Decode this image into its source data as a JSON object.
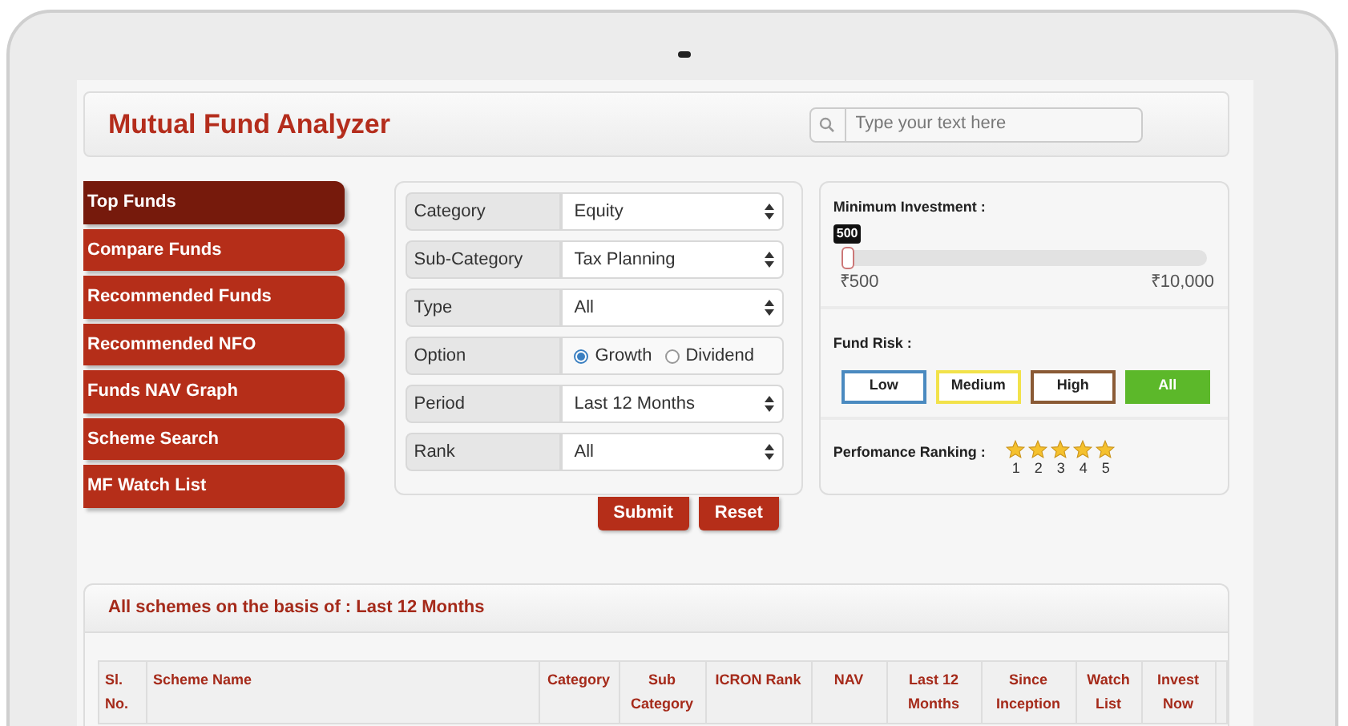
{
  "header": {
    "title": "Mutual Fund Analyzer",
    "search": {
      "placeholder": "Type your text here"
    }
  },
  "sidebar": {
    "items": [
      {
        "label": "Top Funds",
        "selected": true
      },
      {
        "label": "Compare Funds",
        "selected": false
      },
      {
        "label": "Recommended Funds",
        "selected": false
      },
      {
        "label": "Recommended NFO",
        "selected": false
      },
      {
        "label": "Funds NAV Graph",
        "selected": false
      },
      {
        "label": "Scheme Search",
        "selected": false
      },
      {
        "label": "MF Watch List",
        "selected": false
      }
    ]
  },
  "filters": {
    "rows": [
      {
        "label": "Category",
        "kind": "select",
        "value": "Equity"
      },
      {
        "label": "Sub-Category",
        "kind": "select",
        "value": "Tax Planning"
      },
      {
        "label": "Type",
        "kind": "select",
        "value": "All"
      },
      {
        "label": "Option",
        "kind": "radio",
        "options": [
          {
            "label": "Growth",
            "selected": true
          },
          {
            "label": "Dividend",
            "selected": false
          }
        ]
      },
      {
        "label": "Period",
        "kind": "select",
        "value": "Last 12 Months"
      },
      {
        "label": "Rank",
        "kind": "select",
        "value": "All"
      }
    ]
  },
  "buttons": [
    "Submit",
    "Reset"
  ],
  "min_investment": {
    "label": "Minimum Investment :",
    "reading": "500",
    "level": 0,
    "min_label": "₹500",
    "max_label": "₹10,000"
  },
  "fund_risk": {
    "label": "Fund Risk :",
    "options": [
      {
        "label": "Low",
        "color": "#4a8ac0",
        "selected": false
      },
      {
        "label": "Medium",
        "color": "#f2e24a",
        "selected": false
      },
      {
        "label": "High",
        "color": "#8a5a35",
        "selected": false
      },
      {
        "label": "All",
        "color": "#5cb82a",
        "selected": true
      }
    ]
  },
  "ranking": {
    "label": "Perfomance Ranking :",
    "stars": 5,
    "numbers": [
      "1",
      "2",
      "3",
      "4",
      "5"
    ]
  },
  "table": {
    "title": "All schemes on the basis of : Last 12 Months",
    "columns": [
      "Sl. No.",
      "Scheme Name",
      "Category",
      "Sub Category",
      "ICRON Rank",
      "NAV",
      "Last 12 Months",
      "Since Inception",
      "Watch List",
      "Invest Now"
    ]
  }
}
